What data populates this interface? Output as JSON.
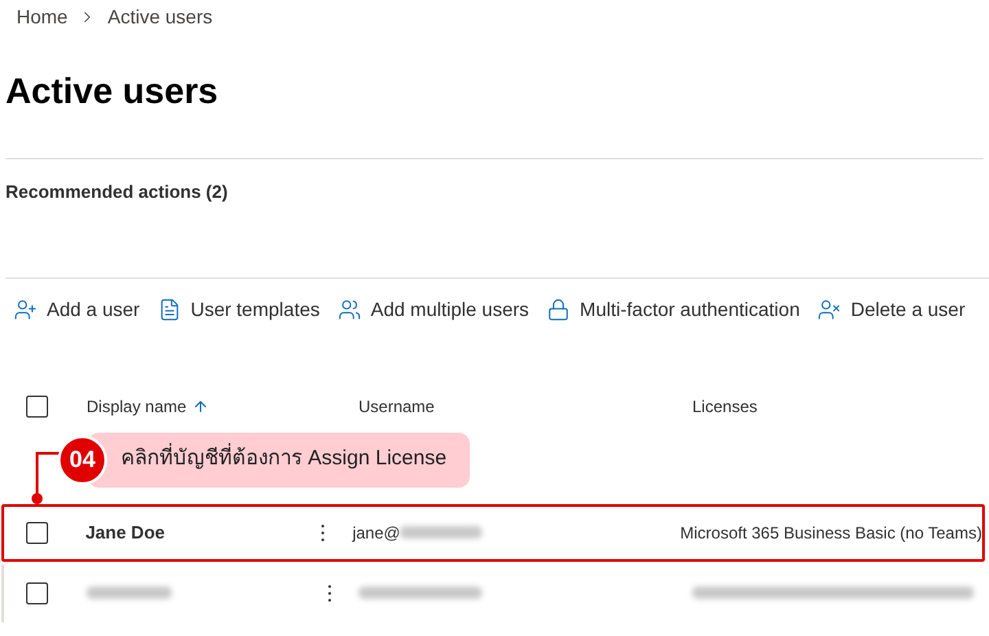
{
  "breadcrumb": [
    "Home",
    "Active users"
  ],
  "title": "Active users",
  "recommended": "Recommended actions (2)",
  "toolbar": [
    "Add a user",
    "User templates",
    "Add multiple users",
    "Multi-factor authentication",
    "Delete a user"
  ],
  "table": {
    "header_checked": false,
    "columns": [
      {
        "label": "Display name",
        "sorted": true
      },
      {
        "label": "Username",
        "sorted": false
      },
      {
        "label": "Licenses",
        "sorted": false
      }
    ],
    "rows": [
      {
        "kind": "user",
        "checked": false,
        "highlighted": true,
        "name": "Jane Doe",
        "username": "jane@",
        "username_masked": true,
        "license": "Microsoft 365 Business Basic (no Teams)"
      },
      {
        "kind": "masked",
        "checked": false,
        "highlighted": false
      }
    ]
  },
  "callout": {
    "step": "04",
    "text": "คลิกที่บัญชีที่ต้องการ Assign License"
  }
}
